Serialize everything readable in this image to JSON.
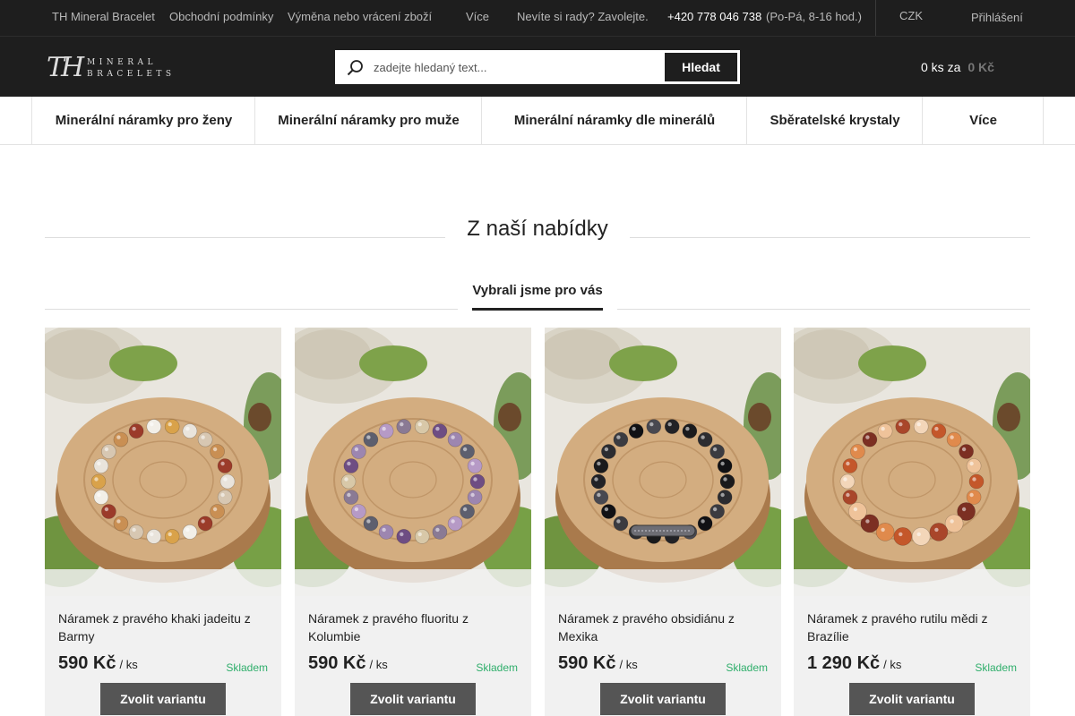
{
  "topbar": {
    "links": [
      "TH Mineral Bracelet",
      "Obchodní podmínky",
      "Výměna nebo vrácení zboží",
      "Více"
    ],
    "help_text": "Nevíte si rady? Zavolejte.",
    "phone": "+420 778 046 738",
    "hours": "(Po-Pá, 8-16 hod.)",
    "currency": "CZK",
    "login": "Přihlášení"
  },
  "header": {
    "logo_monogram": "TH",
    "logo_line1": "MINERAL",
    "logo_line2": "BRACELETS",
    "search_placeholder": "zadejte hledaný text...",
    "search_button": "Hledat",
    "cart_count": "0 ks za",
    "cart_price": "0 Kč"
  },
  "nav": {
    "items": [
      "Minerální náramky pro ženy",
      "Minerální náramky pro muže",
      "Minerální náramky dle minerálů",
      "Sběratelské krystaly",
      "Více"
    ]
  },
  "main": {
    "section_title": "Z naší nabídky",
    "tab_label": "Vybrali jsme pro vás",
    "products": [
      {
        "name": "Náramek z pravého khaki jadeitu z Barmy",
        "price": "590 Kč",
        "unit": "/ ks",
        "stock": "Skladem",
        "button": "Zvolit variantu",
        "bead_colors": [
          "#e9e4dc",
          "#d7c7b2",
          "#c98f53",
          "#9b3b2a",
          "#f2efe8",
          "#d9a24a"
        ]
      },
      {
        "name": "Náramek z pravého fluoritu z Kolumbie",
        "price": "590 Kč",
        "unit": "/ ks",
        "stock": "Skladem",
        "button": "Zvolit variantu",
        "bead_colors": [
          "#6e4d83",
          "#9d86b0",
          "#5d5f6e",
          "#b69ac6",
          "#8a7a94",
          "#d8c8a8"
        ]
      },
      {
        "name": "Náramek z pravého obsidiánu z Mexika",
        "price": "590 Kč",
        "unit": "/ ks",
        "stock": "Skladem",
        "button": "Zvolit variantu",
        "bead_colors": [
          "#1a1a1c",
          "#2c2c30",
          "#3b3b40",
          "#111114",
          "#484850",
          "#222226"
        ]
      },
      {
        "name": "Náramek z pravého rutilu mědi z Brazílie",
        "price": "1 290 Kč",
        "unit": "/ ks",
        "stock": "Skladem",
        "button": "Zvolit variantu",
        "bead_colors": [
          "#c4572a",
          "#e08a4c",
          "#7c2f22",
          "#efc39a",
          "#a9462a",
          "#f3d6b9"
        ]
      }
    ]
  },
  "colors": {
    "dark": "#1e1e1e",
    "accent_stock": "#2fae6b",
    "button": "#555555"
  }
}
